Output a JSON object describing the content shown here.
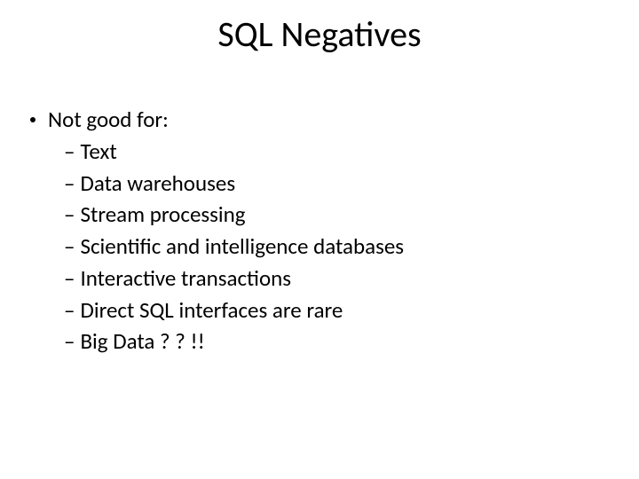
{
  "slide": {
    "title": "SQL Negatives",
    "bullets": [
      {
        "level": 1,
        "text": "Not good for:"
      },
      {
        "level": 2,
        "text": "Text"
      },
      {
        "level": 2,
        "text": "Data warehouses"
      },
      {
        "level": 2,
        "text": "Stream processing"
      },
      {
        "level": 2,
        "text": "Scientific and intelligence databases"
      },
      {
        "level": 2,
        "text": "Interactive transactions"
      },
      {
        "level": 2,
        "text": "Direct SQL interfaces are rare"
      },
      {
        "level": 2,
        "text": "Big Data ? ? !!"
      }
    ]
  }
}
